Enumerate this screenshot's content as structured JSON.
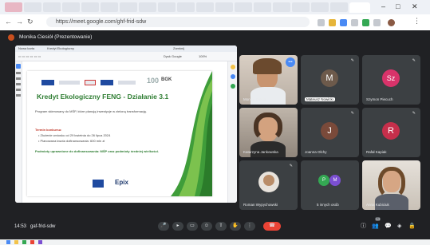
{
  "browser": {
    "close_label": "Zamknij",
    "url": "https://meet.google.com/ghf-frid-sdw",
    "window_controls": [
      "–",
      "□",
      "✕"
    ]
  },
  "meet": {
    "presenter_label": "Monika Ciesiół (Prezentowanie)",
    "presenter_initial": "M",
    "time": "14:53",
    "meeting_code": "gaf-frid-sdw",
    "participant_count": "14"
  },
  "slide": {
    "title": "Kredyt Ekologiczny FENG - Działanie 3.1",
    "logo_right": "100",
    "logo_bgk": "BGK",
    "logo_bottom": "Epix",
    "intro": "Program skierowany do MŚP, które planują inwestycje w zieloną transformację.",
    "section1_title": "Termin konkursu:",
    "bullets": [
      "Złożenie wniosku od 29 kwietnia do 26 lipca 2024",
      "Planowana kwota dofinansowania: 600 mln zł"
    ],
    "footer_text": "Podmioty uprawnione do dofinansowania: MŚP oraz podmioty średniej wielkości."
  },
  "share_toolbar": {
    "tab1": "Nowa karta",
    "tab2": "Kredyt Ekologiczny",
    "zoom": "100%",
    "drive_label": "Dysk Google"
  },
  "participants": [
    {
      "name": "Monika Ciesiół",
      "initial": "",
      "type": "video"
    },
    {
      "name": "Mateusz Nowicki",
      "initial": "M",
      "type": "avatar",
      "color": "#6d5a4b"
    },
    {
      "name": "Szymon Piecuch",
      "initial": "Sz",
      "type": "avatar",
      "color": "#d8336a"
    },
    {
      "name": "Katarzyna Jankowska",
      "initial": "",
      "type": "video"
    },
    {
      "name": "Joanna Olchy",
      "initial": "J",
      "type": "avatar",
      "color": "#7a4a3a"
    },
    {
      "name": "Rafał Kapiak",
      "initial": "R",
      "type": "avatar",
      "color": "#c62f4b"
    },
    {
      "name": "Roman Wypychowski",
      "initial": "",
      "type": "video"
    },
    {
      "name": "5 innych osób",
      "initial": "P M",
      "type": "group"
    },
    {
      "name": "Anna Kubiciuk",
      "initial": "",
      "type": "video"
    }
  ],
  "colors": {
    "meet_bg": "#202124",
    "tile_bg": "#3c4043",
    "end_call": "#ea4335",
    "presenter_dot": "#c94f1e",
    "slide_title": "#2e7d32"
  },
  "icons": [
    "back-icon",
    "forward-icon",
    "reload-icon",
    "mic-icon",
    "camera-icon",
    "captions-icon",
    "emoji-icon",
    "present-icon",
    "raise-hand-icon",
    "more-icon",
    "end-call-icon",
    "info-icon",
    "people-icon",
    "chat-icon",
    "activities-icon"
  ]
}
